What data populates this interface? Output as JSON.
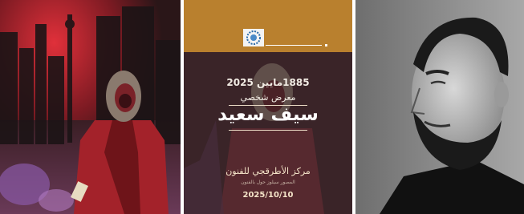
{
  "poster": {
    "date_line": "1885مايين 2025",
    "exhibition_type": "معرض شخصي",
    "artist_name": "سيف سعيد",
    "venue": "مركز الأطرقجي للفنون",
    "venue_subtitle": "المصور سيلوز حول بالفنون",
    "end_date": "2025/10/10"
  },
  "colors": {
    "header_band": "#b9802e",
    "poster_background": "#3a2428",
    "painting_red": "#a3222a",
    "portrait_background": "#8e8e8e"
  },
  "icons": {
    "logo": "circular-emblem-icon"
  }
}
